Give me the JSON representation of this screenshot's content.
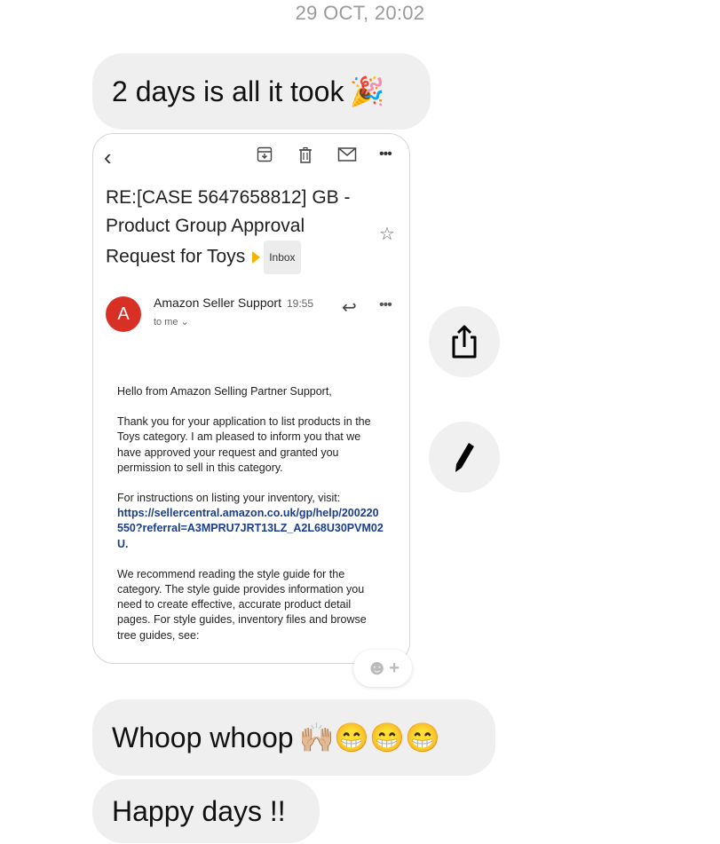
{
  "timestamp": "29 OCT, 20:02",
  "messages": [
    {
      "text": "2 days is all it took",
      "emoji": "🎉"
    },
    {
      "text": "Whoop whoop",
      "emoji": "🙌🏼😁😁😁"
    },
    {
      "text": "Happy days !!"
    }
  ],
  "email": {
    "subject": "RE:[CASE 5647658812] GB - Product Group Approval Request for Toys",
    "label": "Inbox",
    "avatar_letter": "A",
    "sender": "Amazon Seller Support",
    "time": "19:55",
    "recipient": "to me",
    "body": {
      "greeting": "Hello from Amazon Selling Partner Support,",
      "p1": "Thank you for your application to list products in the Toys category. I am pleased to inform you that we have approved your request and granted you permission to sell in this category.",
      "p2": "For instructions on listing your inventory, visit:",
      "link": "https://sellercentral.amazon.co.uk/gp/help/200220550?referral=A3MPRU7JRT13LZ_A2L68U30PVM02U.",
      "p3": "We recommend reading the style guide for the category. The style guide provides information you need to create effective, accurate product detail pages. For style guides, inventory files and browse tree guides, see:"
    }
  },
  "colors": {
    "bubble": "#efefef",
    "avatar": "#d93025",
    "link": "#1a3e8c",
    "important": "#f4b400"
  },
  "icons": [
    "back-icon",
    "archive-icon",
    "trash-icon",
    "mail-icon",
    "more-icon",
    "star-icon",
    "reply-icon",
    "smiley-add-icon",
    "share-icon",
    "pencil-icon"
  ]
}
